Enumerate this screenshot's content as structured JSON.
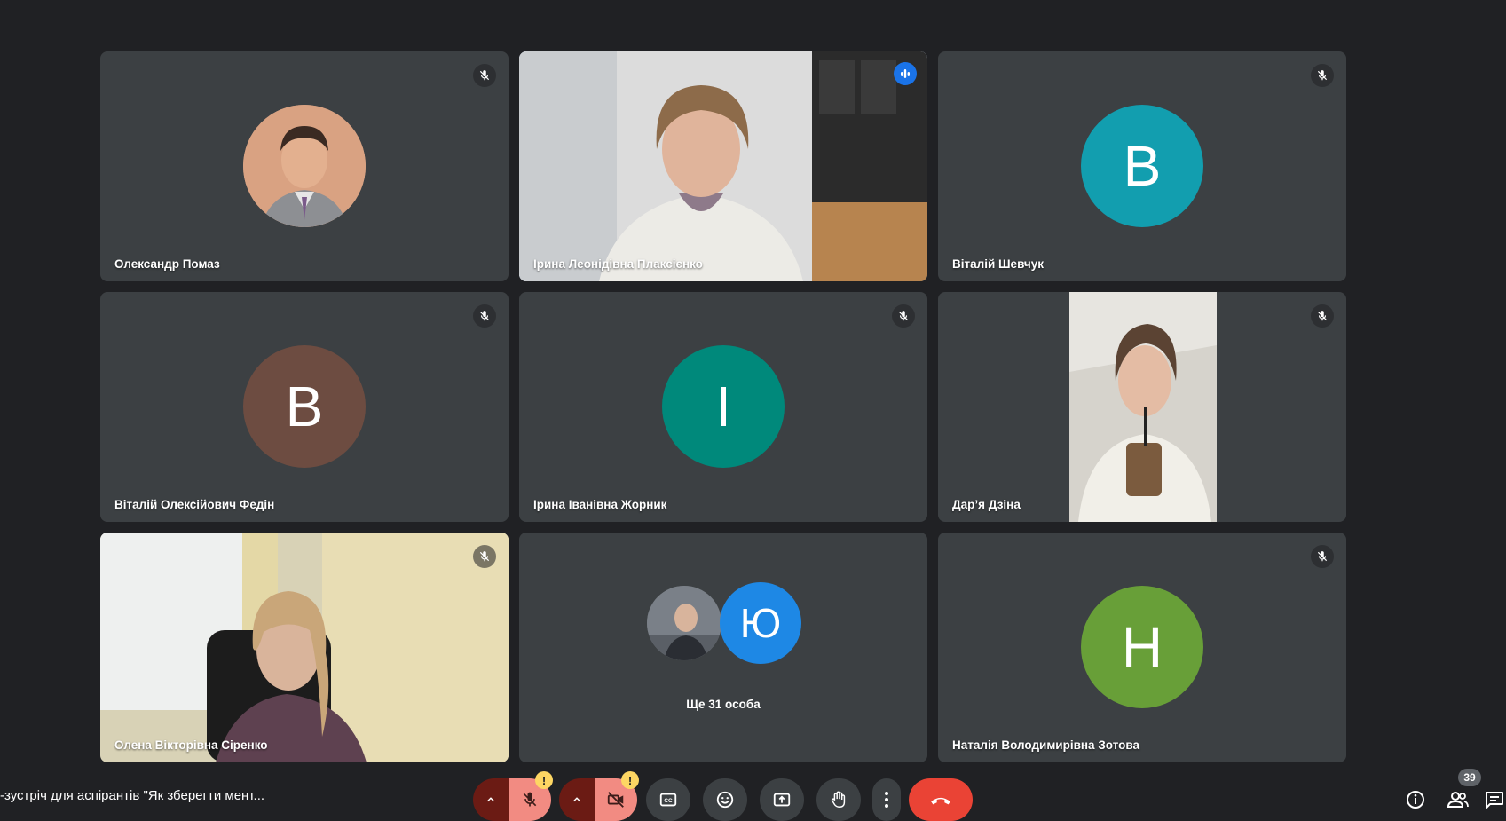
{
  "meeting": {
    "title": "-зустріч для аспірантів \"Як зберегти мент...",
    "participant_count": "39"
  },
  "tiles": [
    {
      "name": "Олександр Помаз",
      "type": "photo-avatar",
      "muted": true
    },
    {
      "name": "Ірина Леонідівна Плаксієнко",
      "type": "video",
      "speaking": true
    },
    {
      "name": "Віталій Шевчук",
      "type": "letter-avatar",
      "letter": "В",
      "color": "#129eaf",
      "muted": true
    },
    {
      "name": "Віталій Олексійович Федін",
      "type": "letter-avatar",
      "letter": "В",
      "color": "#6d4c41",
      "muted": true
    },
    {
      "name": "Ірина Іванівна Жорник",
      "type": "letter-avatar",
      "letter": "І",
      "color": "#00897b",
      "muted": true
    },
    {
      "name": "Дар’я Дзіна",
      "type": "video",
      "muted": true
    },
    {
      "name": "Олена Вікторівна Сіренко",
      "type": "video",
      "muted": true
    },
    {
      "more_label": "Ще 31 особа",
      "avatar_letter": "Ю",
      "avatar_color": "#1e88e5",
      "type": "overflow"
    },
    {
      "name": "Наталія Володимирівна Зотова",
      "type": "letter-avatar",
      "letter": "Н",
      "color": "#689f38",
      "muted": true
    }
  ],
  "controls": {
    "warning_mark": "!",
    "icons": [
      "chevron-up-icon",
      "mic-off-icon",
      "chevron-up-icon",
      "camera-off-icon",
      "captions-icon",
      "emoji-icon",
      "present-icon",
      "raise-hand-icon",
      "more-options-icon",
      "hang-up-icon"
    ]
  },
  "right_icons": [
    "info-icon",
    "people-icon",
    "chat-icon"
  ],
  "colors": {
    "background": "#202124",
    "tile": "#3c4043",
    "active_border": "#8ab4f8",
    "hangup": "#ea4335",
    "muted_control": "#f28b82",
    "warning": "#fdd663"
  }
}
